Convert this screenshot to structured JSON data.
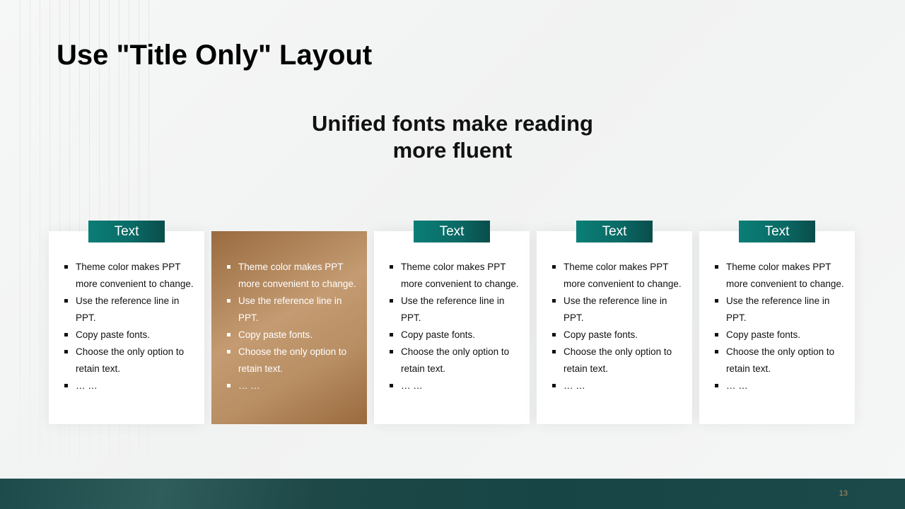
{
  "slide": {
    "title": "Use \"Title Only\" Layout",
    "subtitle_line1": "Unified fonts make reading",
    "subtitle_line2": "more fluent",
    "page_number": "13"
  },
  "cards": [
    {
      "tag": "Text",
      "items": [
        "Theme  color makes PPT more convenient  to change.",
        "Use the reference line in PPT.",
        "Copy paste fonts.",
        "Choose the only option to retain text.",
        "… …"
      ]
    },
    {
      "tag": "",
      "items": [
        "Theme  color makes PPT more convenient  to change.",
        "Use the reference line in PPT.",
        "Copy paste fonts.",
        "Choose the only option to retain text.",
        "… …"
      ]
    },
    {
      "tag": "Text",
      "items": [
        "Theme  color makes PPT more convenient  to change.",
        "Use the reference line in PPT.",
        "Copy paste fonts.",
        "Choose the only option to retain text.",
        "… …"
      ]
    },
    {
      "tag": "Text",
      "items": [
        "Theme  color makes PPT more convenient  to change.",
        "Use the reference line in PPT.",
        "Copy paste fonts.",
        "Choose the only option to retain text.",
        "… …"
      ]
    },
    {
      "tag": "Text",
      "items": [
        "Theme  color makes PPT more convenient  to change.",
        "Use the reference line in PPT.",
        "Copy paste fonts.",
        "Choose the only option to retain text.",
        "… …"
      ]
    }
  ],
  "colors": {
    "teal_accent": "#0b7e76",
    "bronze_accent": "#b88e63",
    "footer_band": "#1d4a4a"
  }
}
